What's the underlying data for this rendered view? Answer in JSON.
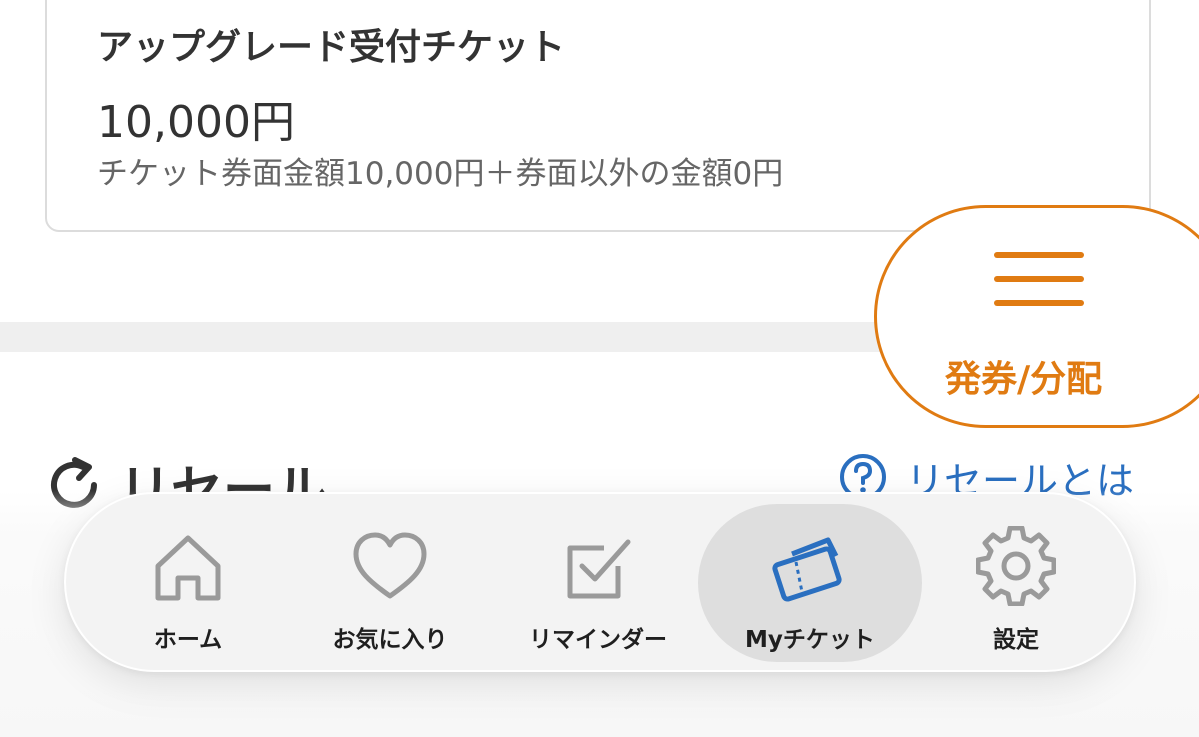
{
  "ticket": {
    "title": "アップグレード受付チケット",
    "price": "10,000円",
    "breakdown": "チケット券面金額10,000円＋券面以外の金額0円"
  },
  "resale": {
    "title": "リセール",
    "help_label": "リセールとは",
    "icon": "refresh-icon",
    "help_icon": "question-circle-icon"
  },
  "issue_button": {
    "label": "発券/分配",
    "icon": "hamburger-menu-icon"
  },
  "bottom_nav": {
    "items": [
      {
        "label": "ホーム",
        "icon": "home-icon",
        "active": false
      },
      {
        "label": "お気に入り",
        "icon": "heart-icon",
        "active": false
      },
      {
        "label": "リマインダー",
        "icon": "checkbox-icon",
        "active": false
      },
      {
        "label": "Myチケット",
        "icon": "ticket-icon",
        "active": true
      },
      {
        "label": "設定",
        "icon": "gear-icon",
        "active": false
      }
    ]
  },
  "colors": {
    "accent": "#e07b12",
    "link": "#2a6fc0",
    "active_icon": "#2a6fc0",
    "inactive_icon": "#9a9a9a",
    "text": "#333333"
  }
}
